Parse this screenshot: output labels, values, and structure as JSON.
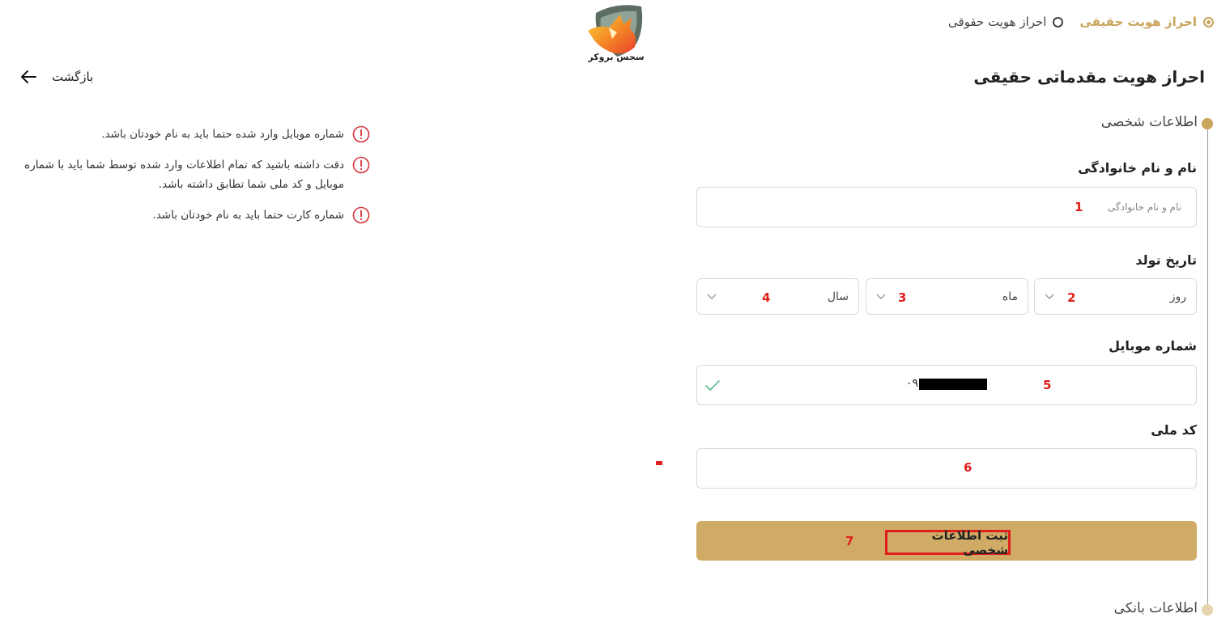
{
  "colors": {
    "accent": "#c9a45c",
    "button": "#cfab66",
    "marker": "#e0201c",
    "success": "#5cb98c"
  },
  "steps": [
    {
      "label": "احراز هویت حقیقی",
      "active": true
    },
    {
      "label": "احراز هویت حقوقی",
      "active": false
    }
  ],
  "logo": {
    "icon": "fox-shield-logo",
    "text": "سجس بروکر"
  },
  "back": {
    "label": "بازگشت",
    "icon": "arrow-left-icon"
  },
  "page_title": "احراز هویت مقدماتی حقیقی",
  "sections": {
    "personal": "اطلاعات شخصی",
    "bank": "اطلاعات بانکی"
  },
  "form": {
    "name": {
      "label": "نام و نام خانوادگی",
      "placeholder": "نام و نام خانوادگی",
      "marker": "1"
    },
    "birthdate": {
      "label": "تاریخ تولد",
      "day": {
        "value": "روز",
        "marker": "2"
      },
      "month": {
        "value": "ماه",
        "marker": "3"
      },
      "year": {
        "value": "سال",
        "marker": "4"
      }
    },
    "mobile": {
      "label": "شماره موبایل",
      "value_prefix": "۰۹",
      "marker": "5",
      "status_icon": "check-icon"
    },
    "national_code": {
      "label": "کد ملی",
      "marker": "6"
    },
    "submit": {
      "label": "ثبت اطلاعات شخصی",
      "marker": "7"
    }
  },
  "notes": [
    "شماره موبایل وارد شده حتما باید به نام خودتان باشد.",
    "دقت داشته باشید که تمام اطلاعات وارد شده توسط شما باید با شماره موبایل و کد ملی شما تطابق داشته باشد.",
    "شماره کارت حتما باید به نام خودتان باشد."
  ]
}
